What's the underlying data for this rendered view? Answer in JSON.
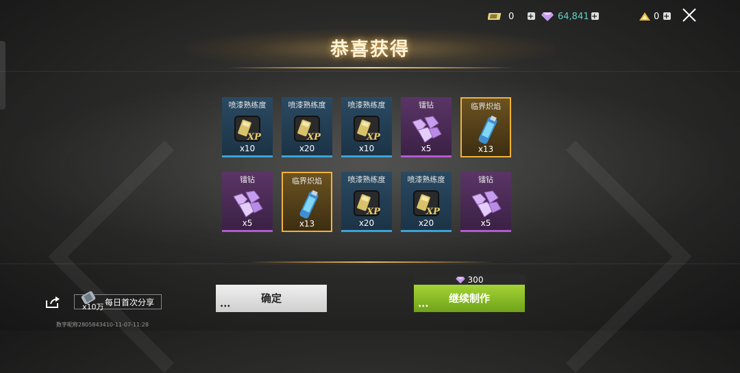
{
  "currency": {
    "tickets": "0",
    "diamonds": "64,841",
    "gold": "0",
    "diamond_color": "#5fd3c3"
  },
  "title": "恭喜获得",
  "rewards": [
    {
      "name": "喷漆熟练度",
      "qty": "x10",
      "icon": "xp-spray-icon",
      "rarity": "blue"
    },
    {
      "name": "镭钻",
      "qty": "x5",
      "icon": "diamond-cluster-icon",
      "rarity": "purple"
    },
    {
      "name": "喷漆熟练度",
      "qty": "x20",
      "icon": "xp-spray-icon",
      "rarity": "blue"
    },
    {
      "name": "临界炽焰",
      "qty": "x13",
      "icon": "spray-can-icon",
      "rarity": "gold"
    },
    {
      "name": "喷漆熟练度",
      "qty": "x10",
      "icon": "xp-spray-icon",
      "rarity": "blue"
    },
    {
      "name": "喷漆熟练度",
      "qty": "x20",
      "icon": "xp-spray-icon",
      "rarity": "blue"
    },
    {
      "name": "镭钻",
      "qty": "x5",
      "icon": "diamond-cluster-icon",
      "rarity": "purple"
    },
    {
      "name": "喷漆熟练度",
      "qty": "x20",
      "icon": "xp-spray-icon",
      "rarity": "blue"
    },
    {
      "name": "临界炽焰",
      "qty": "x13",
      "icon": "spray-can-icon",
      "rarity": "gold"
    },
    {
      "name": "镭钻",
      "qty": "x5",
      "icon": "diamond-cluster-icon",
      "rarity": "purple"
    }
  ],
  "share": {
    "qty": "x10万",
    "label": "每日首次分享"
  },
  "watermark": "数字昵称2805843410-11-07-11:28",
  "buttons": {
    "confirm": "确定",
    "continue": "继续制作",
    "continue_cost": "300"
  },
  "colors": {
    "blue_rarity": "#3aa5d8",
    "purple_rarity": "#b45ad0",
    "gold_rarity": "#f2b33d",
    "continue_button": "#8cc22a"
  }
}
